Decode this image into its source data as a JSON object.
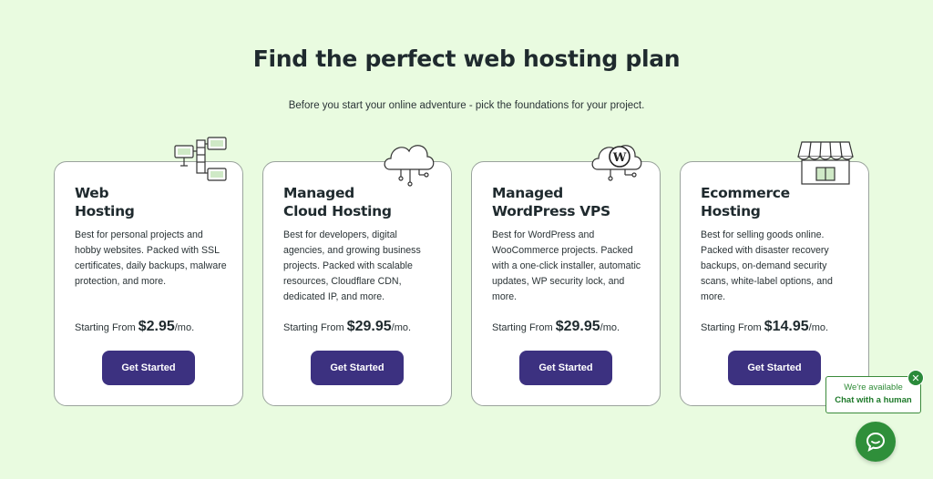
{
  "heading": "Find the perfect web hosting plan",
  "subheading": "Before you start your online adventure - pick the foundations for your project.",
  "plans": [
    {
      "title_line1": "Web",
      "title_line2": "Hosting",
      "description": "Best for personal projects and hobby websites. Packed with SSL certificates, daily backups, malware protection, and more.",
      "price_prefix": "Starting From",
      "price": "$2.95",
      "price_suffix": "/mo.",
      "button_label": "Get Started",
      "icon": "servers-icon"
    },
    {
      "title_line1": "Managed",
      "title_line2": "Cloud Hosting",
      "description": "Best for developers, digital agencies, and growing business projects. Packed with scalable resources, Cloudflare CDN, dedicated IP, and more.",
      "price_prefix": "Starting From",
      "price": "$29.95",
      "price_suffix": "/mo.",
      "button_label": "Get Started",
      "icon": "cloud-icon"
    },
    {
      "title_line1": "Managed",
      "title_line2": "WordPress VPS",
      "description": "Best for WordPress and WooCommerce projects. Packed with a one-click installer, automatic updates, WP security lock, and more.",
      "price_prefix": "Starting From",
      "price": "$29.95",
      "price_suffix": "/mo.",
      "button_label": "Get Started",
      "icon": "wordpress-icon"
    },
    {
      "title_line1": "Ecommerce",
      "title_line2": "Hosting",
      "description": "Best for selling goods online. Packed with disaster recovery backups, on-demand security scans, white-label options, and more.",
      "price_prefix": "Starting From",
      "price": "$14.95",
      "price_suffix": "/mo.",
      "button_label": "Get Started",
      "icon": "storefront-icon"
    }
  ],
  "chat": {
    "status": "We're available",
    "cta": "Chat with a human",
    "close_symbol": "✕"
  },
  "colors": {
    "background": "#e9fbe0",
    "button": "#3c3180",
    "chat_green": "#2f8f3a"
  }
}
